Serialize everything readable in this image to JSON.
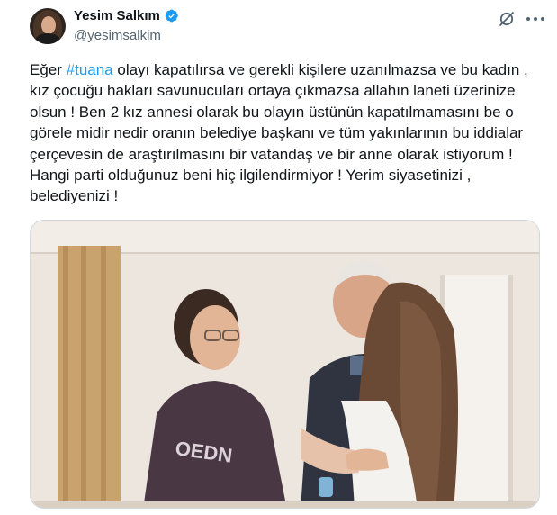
{
  "tweet": {
    "author": {
      "display_name": "Yesim Salkım",
      "handle": "@yesimsalkim",
      "verified": true,
      "avatar_icon": "profile-photo"
    },
    "text_before_hashtag": "Eğer ",
    "hashtag": "#tuana",
    "text_after_hashtag": " olayı kapatılırsa ve gerekli kişilere uzanılmazsa ve bu kadın ,\nkız çocuğu hakları savunucuları ortaya çıkmazsa allahın laneti üzerinize\nolsun ! Ben 2 kız annesi olarak bu olayın üstünün kapatılmamasını be o\ngörele midir nedir oranın belediye başkanı ve tüm yakınlarının bu iddialar\nçerçevesin de araştırılmasını bir vatandaş ve bir anne olarak istiyorum !\nHangi parti olduğunuz beni hiç ilgilendirmiyor ! Yerim siyasetinizi ,\nbelediyenizi !",
    "actions": {
      "grok_icon": "grok-icon",
      "more_icon": "more-icon"
    },
    "media": {
      "type": "photo",
      "description_icon": "photo-three-people-hugging"
    },
    "colors": {
      "accent": "#1d9bf0",
      "text": "#0f1419",
      "secondary": "#536471",
      "border": "#cfd9de"
    }
  }
}
